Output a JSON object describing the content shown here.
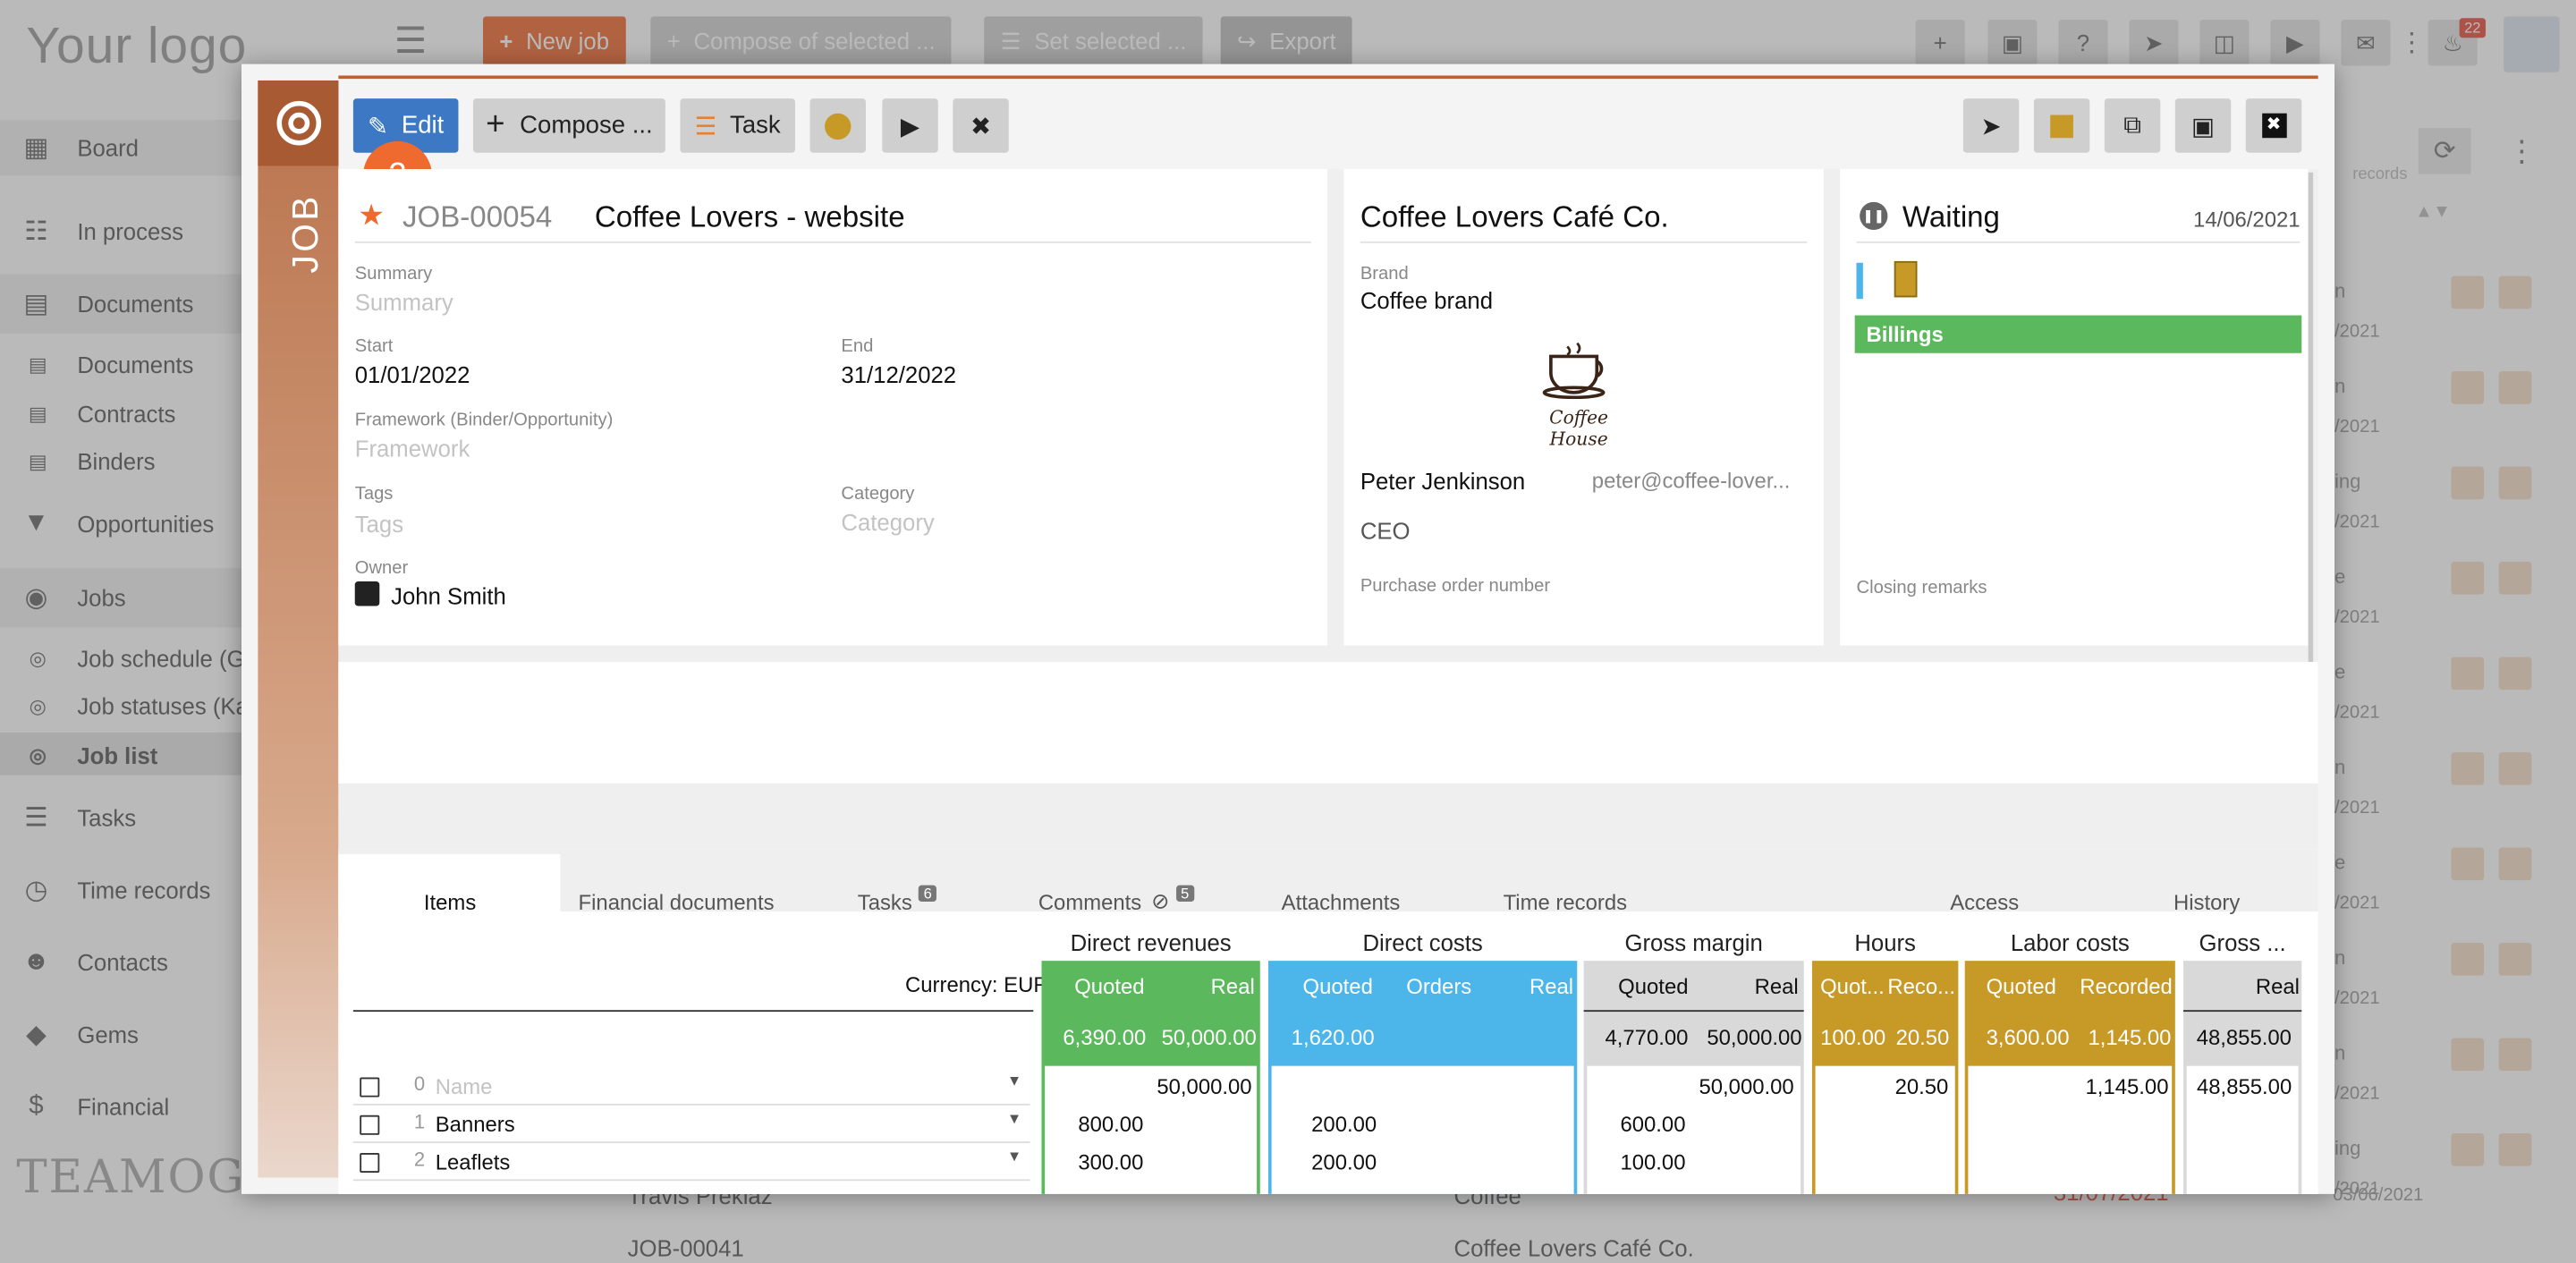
{
  "background": {
    "logo": "Your logo",
    "footer_logo": "TEAMOGY",
    "nav": [
      {
        "label": "Board",
        "icon": "board-icon"
      },
      {
        "label": "In process",
        "icon": "process-icon"
      },
      {
        "label": "Documents",
        "icon": "document-icon"
      },
      {
        "label": "Documents",
        "icon": "document-icon"
      },
      {
        "label": "Contracts",
        "icon": "document-icon"
      },
      {
        "label": "Binders",
        "icon": "document-icon"
      },
      {
        "label": "Opportunities",
        "icon": "funnel-icon"
      },
      {
        "label": "Jobs",
        "icon": "target-icon"
      },
      {
        "label": "Job schedule (G",
        "icon": "target-icon"
      },
      {
        "label": "Job statuses (Ka",
        "icon": "target-icon"
      },
      {
        "label": "Job list",
        "icon": "target-icon"
      },
      {
        "label": "Tasks",
        "icon": "tasks-icon"
      },
      {
        "label": "Time records",
        "icon": "clock-icon"
      },
      {
        "label": "Contacts",
        "icon": "contacts-icon"
      },
      {
        "label": "Gems",
        "icon": "gem-icon"
      },
      {
        "label": "Financial",
        "icon": "dollar-icon"
      }
    ],
    "top_buttons": {
      "new_job": "New job",
      "compose": "Compose of selected ...",
      "set_selected": "Set selected ...",
      "export": "Export"
    },
    "notification_count": "22",
    "records_label": "records",
    "list_fragments": [
      "/2021",
      "/2021",
      "/2021",
      "/2021",
      "/2021",
      "/2021",
      "/2021",
      "/2021",
      "/2021",
      "/2021"
    ],
    "list_side": [
      "n",
      "n",
      "ing",
      "e",
      "e",
      "n",
      "e",
      "n",
      "n",
      "ing"
    ],
    "footer_row": {
      "name": "Travis Preklaz",
      "category": "Coffee",
      "date": "31/07/2021",
      "date2": "03/06/2021",
      "next_row": "JOB-00041",
      "next_client": "Coffee Lovers Café Co."
    }
  },
  "modal": {
    "strip_label": "JOB",
    "toolbar": {
      "edit": "Edit",
      "compose": "Compose ...",
      "task": "Task",
      "badge": "2"
    },
    "job": {
      "number": "JOB-00054",
      "title": "Coffee Lovers - website",
      "summary_label": "Summary",
      "summary_placeholder": "Summary",
      "start_label": "Start",
      "start": "01/01/2022",
      "end_label": "End",
      "end": "31/12/2022",
      "framework_label": "Framework (Binder/Opportunity)",
      "framework_placeholder": "Framework",
      "tags_label": "Tags",
      "tags_placeholder": "Tags",
      "category_label": "Category",
      "category_placeholder": "Category",
      "owner_label": "Owner",
      "owner": "John Smith"
    },
    "client": {
      "name": "Coffee Lovers Café Co.",
      "brand_label": "Brand",
      "brand": "Coffee brand",
      "logo_text": "Coffee House",
      "contact_name": "Peter Jenkinson",
      "contact_email": "peter@coffee-lover...",
      "contact_role": "CEO",
      "po_label": "Purchase order number"
    },
    "status": {
      "state": "Waiting",
      "date": "14/06/2021",
      "billings": "Billings",
      "closing_label": "Closing remarks"
    },
    "tabs": [
      {
        "label": "Items",
        "badge": ""
      },
      {
        "label": "Financial documents",
        "badge": ""
      },
      {
        "label": "Tasks",
        "badge": "6"
      },
      {
        "label": "Comments",
        "badge": "5"
      },
      {
        "label": "Attachments",
        "badge": ""
      },
      {
        "label": "Time records",
        "badge": ""
      },
      {
        "label": "Access",
        "badge": ""
      },
      {
        "label": "History",
        "badge": ""
      }
    ],
    "table": {
      "currency": "Currency: EUR",
      "groups": {
        "direct_revenues": "Direct revenues",
        "direct_costs": "Direct costs",
        "gross_margin": "Gross margin",
        "hours": "Hours",
        "labor_costs": "Labor costs",
        "gross_short": "Gross ..."
      },
      "subheads": {
        "dr_quoted": "Quoted",
        "dr_real": "Real",
        "dc_quoted": "Quoted",
        "dc_orders": "Orders",
        "dc_real": "Real",
        "gm_quoted": "Quoted",
        "gm_real": "Real",
        "h_quoted": "Quot...",
        "h_recorded": "Reco...",
        "lc_quoted": "Quoted",
        "lc_recorded": "Recorded",
        "g_real": "Real"
      },
      "totals": {
        "dr_quoted": "6,390.00",
        "dr_real": "50,000.00",
        "dc_quoted": "1,620.00",
        "gm_quoted": "4,770.00",
        "gm_real": "50,000.00",
        "h_quoted": "100.00",
        "h_recorded": "20.50",
        "lc_quoted": "3,600.00",
        "lc_recorded": "1,145.00",
        "g_real": "48,855.00"
      },
      "rows": [
        {
          "num": "0",
          "name": "",
          "name_placeholder": "Name",
          "dr_quoted": "",
          "dr_real": "50,000.00",
          "dc_quoted": "",
          "gm_quoted": "",
          "gm_real": "50,000.00",
          "h_recorded": "20.50",
          "lc_recorded": "1,145.00",
          "g_real": "48,855.00"
        },
        {
          "num": "1",
          "name": "Banners",
          "name_placeholder": "",
          "dr_quoted": "800.00",
          "dr_real": "",
          "dc_quoted": "200.00",
          "gm_quoted": "600.00",
          "gm_real": "",
          "h_recorded": "",
          "lc_recorded": "",
          "g_real": ""
        },
        {
          "num": "2",
          "name": "Leaflets",
          "name_placeholder": "",
          "dr_quoted": "300.00",
          "dr_real": "",
          "dc_quoted": "200.00",
          "gm_quoted": "100.00",
          "gm_real": "",
          "h_recorded": "",
          "lc_recorded": "",
          "g_real": ""
        }
      ]
    }
  },
  "colors": {
    "accent": "#ef6a2f",
    "job_strip": "#b9734c",
    "revenues": "#5cb85c",
    "costs": "#4cb6ea",
    "margin": "#d9d9d9",
    "hours": "#c79a28",
    "edit": "#3c78c3",
    "status_green": "#5cb85c"
  }
}
